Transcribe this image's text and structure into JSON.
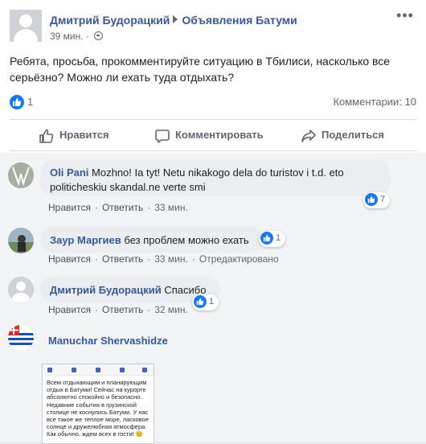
{
  "post": {
    "author": "Дмитрий Будорацкий",
    "group": "Объявления Батуми",
    "time": "39 мин.",
    "text": "Ребята, просьба, прокомментируйте ситуацию в Тбилиси, насколько все серьёзно? Можно ли ехать туда отдыхать?",
    "reactions_count": "1",
    "comments_count": "Комментарии: 10"
  },
  "actions": {
    "like": "Нравится",
    "comment": "Комментировать",
    "share": "Поделиться"
  },
  "comments": [
    {
      "name": "Oli Pani",
      "text_line1": "Mozhno! Ia tyt! Netu nikakogo dela do turistov i t.d. eto",
      "text_line2": "politicheskiu skandal.ne verte smi",
      "like": "Нравится",
      "reply": "Ответить",
      "time": "33 мин.",
      "likes": "7"
    },
    {
      "name": "Заур Маргиев",
      "text": "без проблем можно ехать",
      "like": "Нравится",
      "reply": "Ответить",
      "time": "33 мин.",
      "edited": "Отредактировано",
      "likes": "1"
    },
    {
      "name": "Дмитрий Будорацкий",
      "text": "Спасибо",
      "like": "Нравится",
      "reply": "Ответить",
      "time": "32 мин.",
      "likes": "1"
    },
    {
      "name": "Manuchar Shervashidze",
      "image_text": "Всем отдыхающим и планирующим отдых в Батуми! Сейчас на курорте абсолютно спокойно и безопасно. Недавние события в грузинской столице не коснулись Батуми. У нас все такое же теплое море, ласковое солнце и дружелюбная атмосфера. Как обычно, ждем всех в гости! 😊"
    }
  ],
  "colors": {
    "link_blue": "#385898",
    "like_blue": "#1877f2",
    "muted": "#606770"
  }
}
